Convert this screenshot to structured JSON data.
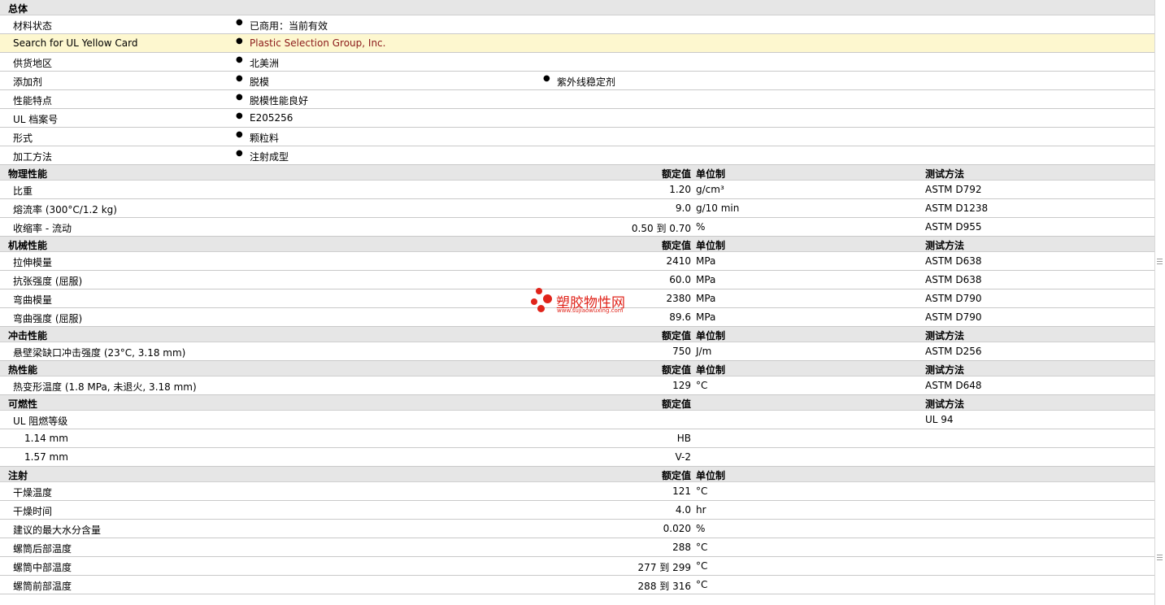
{
  "general": {
    "title": "总体",
    "rows": [
      {
        "label": "材料状态",
        "values": [
          "已商用：当前有效"
        ]
      },
      {
        "label": "Search for UL Yellow Card",
        "values": [
          "Plastic Selection Group, Inc."
        ],
        "link": true
      },
      {
        "label": "供货地区",
        "values": [
          "北美洲"
        ]
      },
      {
        "label": "添加剂",
        "values": [
          "脱模",
          "紫外线稳定剂"
        ]
      },
      {
        "label": "性能特点",
        "values": [
          "脱模性能良好"
        ]
      },
      {
        "label": "UL 档案号",
        "values": [
          "E205256"
        ]
      },
      {
        "label": "形式",
        "values": [
          "颗粒料"
        ]
      },
      {
        "label": "加工方法",
        "values": [
          "注射成型"
        ]
      }
    ]
  },
  "headers": {
    "value": "额定值",
    "unit": "单位制",
    "method": "测试方法"
  },
  "sections": [
    {
      "title": "物理性能",
      "cols": [
        "value",
        "unit",
        "method"
      ],
      "rows": [
        {
          "label": "比重",
          "value": "1.20",
          "unit": "g/cm³",
          "method": "ASTM D792"
        },
        {
          "label": "熔流率  (300°C/1.2 kg)",
          "value": "9.0",
          "unit": "g/10 min",
          "method": "ASTM D1238"
        },
        {
          "label": "收缩率  - 流动",
          "value": "0.50 到  0.70",
          "unit": "%",
          "method": "ASTM D955"
        }
      ]
    },
    {
      "title": "机械性能",
      "cols": [
        "value",
        "unit",
        "method"
      ],
      "rows": [
        {
          "label": "拉伸模量",
          "value": "2410",
          "unit": "MPa",
          "method": "ASTM D638"
        },
        {
          "label": "抗张强度  (屈服)",
          "value": "60.0",
          "unit": "MPa",
          "method": "ASTM D638"
        },
        {
          "label": "弯曲模量",
          "value": "2380",
          "unit": "MPa",
          "method": "ASTM D790"
        },
        {
          "label": "弯曲强度  (屈服)",
          "value": "89.6",
          "unit": "MPa",
          "method": "ASTM D790"
        }
      ]
    },
    {
      "title": "冲击性能",
      "cols": [
        "value",
        "unit",
        "method"
      ],
      "rows": [
        {
          "label": "悬壁梁缺口冲击强度  (23°C, 3.18 mm)",
          "value": "750",
          "unit": "J/m",
          "method": "ASTM D256"
        }
      ]
    },
    {
      "title": "热性能",
      "cols": [
        "value",
        "unit",
        "method"
      ],
      "rows": [
        {
          "label": "热变形温度  (1.8 MPa, 未退火, 3.18 mm)",
          "value": "129",
          "unit": "°C",
          "method": "ASTM D648"
        }
      ]
    },
    {
      "title": "可燃性",
      "cols": [
        "value",
        "method"
      ],
      "rows": [
        {
          "label": "UL 阻燃等级",
          "value": "",
          "unit": "",
          "method": "UL 94"
        },
        {
          "label": "1.14 mm",
          "sub": true,
          "value": "HB",
          "unit": "",
          "method": ""
        },
        {
          "label": "1.57 mm",
          "sub": true,
          "value": "V-2",
          "unit": "",
          "method": ""
        }
      ]
    },
    {
      "title": "注射",
      "cols": [
        "value",
        "unit"
      ],
      "rows": [
        {
          "label": "干燥温度",
          "value": "121",
          "unit": "°C",
          "method": ""
        },
        {
          "label": "干燥时间",
          "value": "4.0",
          "unit": "hr",
          "method": ""
        },
        {
          "label": "建议的最大水分含量",
          "value": "0.020",
          "unit": "%",
          "method": ""
        },
        {
          "label": "螺筒后部温度",
          "value": "288",
          "unit": "°C",
          "method": ""
        },
        {
          "label": "螺筒中部温度",
          "value": "277 到  299",
          "unit": "°C",
          "method": ""
        },
        {
          "label": "螺筒前部温度",
          "value": "288 到  316",
          "unit": "°C",
          "method": ""
        }
      ]
    }
  ],
  "watermark": {
    "name": "塑胶物性网",
    "url": "www.sujiaowuxing.com",
    "color": "#e0241b"
  }
}
